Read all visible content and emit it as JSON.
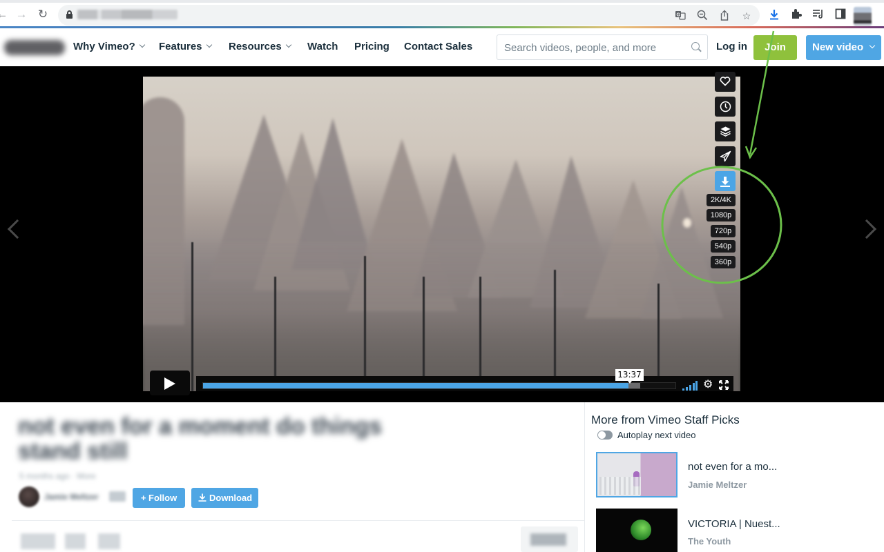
{
  "browser": {
    "back_icon": "arrow-left",
    "forward_icon": "arrow-right",
    "reload_icon": "reload",
    "lock_icon": "lock",
    "url": "",
    "omnibox_icons": [
      "translate",
      "zoom-out",
      "share",
      "bookmark-star"
    ],
    "toolbar_icons": [
      "download",
      "extensions-puzzle",
      "reading-list",
      "side-panel",
      "profile"
    ]
  },
  "header": {
    "logo": "vimeo",
    "nav": [
      {
        "label": "Why Vimeo?",
        "dropdown": true
      },
      {
        "label": "Features",
        "dropdown": true
      },
      {
        "label": "Resources",
        "dropdown": true
      },
      {
        "label": "Watch",
        "dropdown": false
      },
      {
        "label": "Pricing",
        "dropdown": false
      },
      {
        "label": "Contact Sales",
        "dropdown": false
      }
    ],
    "search_placeholder": "Search videos, people, and more",
    "login_label": "Log in",
    "join_label": "Join",
    "new_video_label": "New video"
  },
  "player": {
    "side_actions": [
      "like",
      "watch-later",
      "collections",
      "share",
      "download"
    ],
    "download_resolutions": [
      "2K/4K",
      "1080p",
      "720p",
      "540p",
      "360p"
    ],
    "time_tooltip": "13:37",
    "played_fraction": 0.9,
    "buffered_fraction": 0.925,
    "colors": {
      "accent": "#4ba5e6"
    }
  },
  "video_info": {
    "title": "not even for a moment do things stand still",
    "meta": "5 months ago · More",
    "author": "Jamie Meltzer",
    "badge": "PRO",
    "follow_label": "+ Follow",
    "download_label": "Download"
  },
  "sidebar": {
    "title": "More from Vimeo Staff Picks",
    "autoplay_label": "Autoplay next video",
    "autoplay_on": false,
    "items": [
      {
        "title": "not even for a mo...",
        "author": "Jamie Meltzer"
      },
      {
        "title": "VICTORIA | Nuest...",
        "author": "The Youth"
      }
    ]
  },
  "colors": {
    "join": "#8fc13c",
    "primary": "#4fa6e4",
    "annotation": "#6cc04a"
  }
}
